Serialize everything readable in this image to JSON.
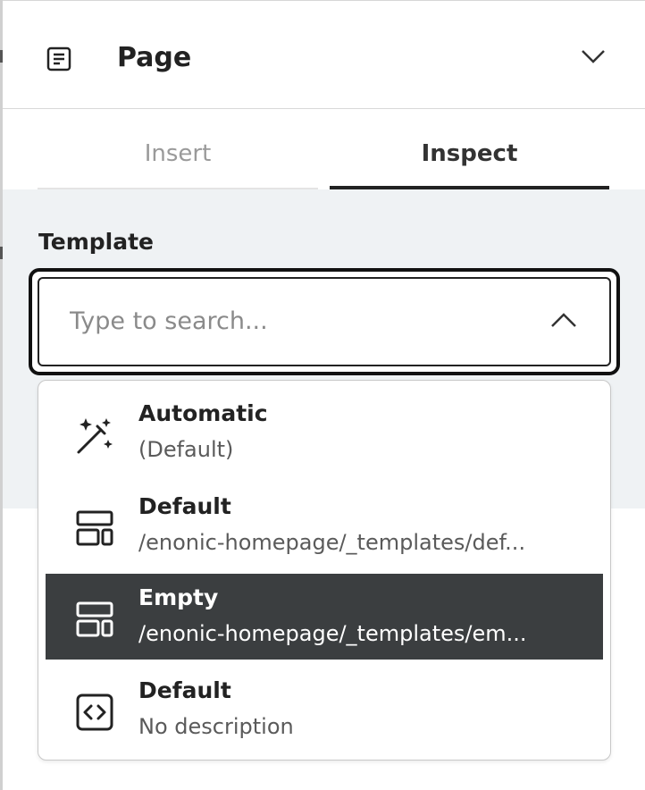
{
  "header": {
    "title": "Page",
    "page_icon": "page-icon",
    "collapse_icon": "chevron-down-icon"
  },
  "tabs": [
    {
      "label": "Insert",
      "active": false
    },
    {
      "label": "Inspect",
      "active": true
    }
  ],
  "template": {
    "label": "Template",
    "search_placeholder": "Type to search...",
    "search_value": "",
    "toggle_icon": "chevron-up-icon"
  },
  "options": [
    {
      "title": "Automatic",
      "description": "(Default)",
      "icon": "magic-wand-icon",
      "selected": false
    },
    {
      "title": "Default",
      "description": "/enonic-homepage/_templates/def...",
      "icon": "layout-icon",
      "selected": false
    },
    {
      "title": "Empty",
      "description": "/enonic-homepage/_templates/em...",
      "icon": "layout-icon",
      "selected": true
    },
    {
      "title": "Default",
      "description": "No description",
      "icon": "code-icon",
      "selected": false
    }
  ],
  "colors": {
    "selected_bg": "#3b3e40",
    "content_bg": "#eff2f4",
    "active_tab_border": "#222222"
  }
}
